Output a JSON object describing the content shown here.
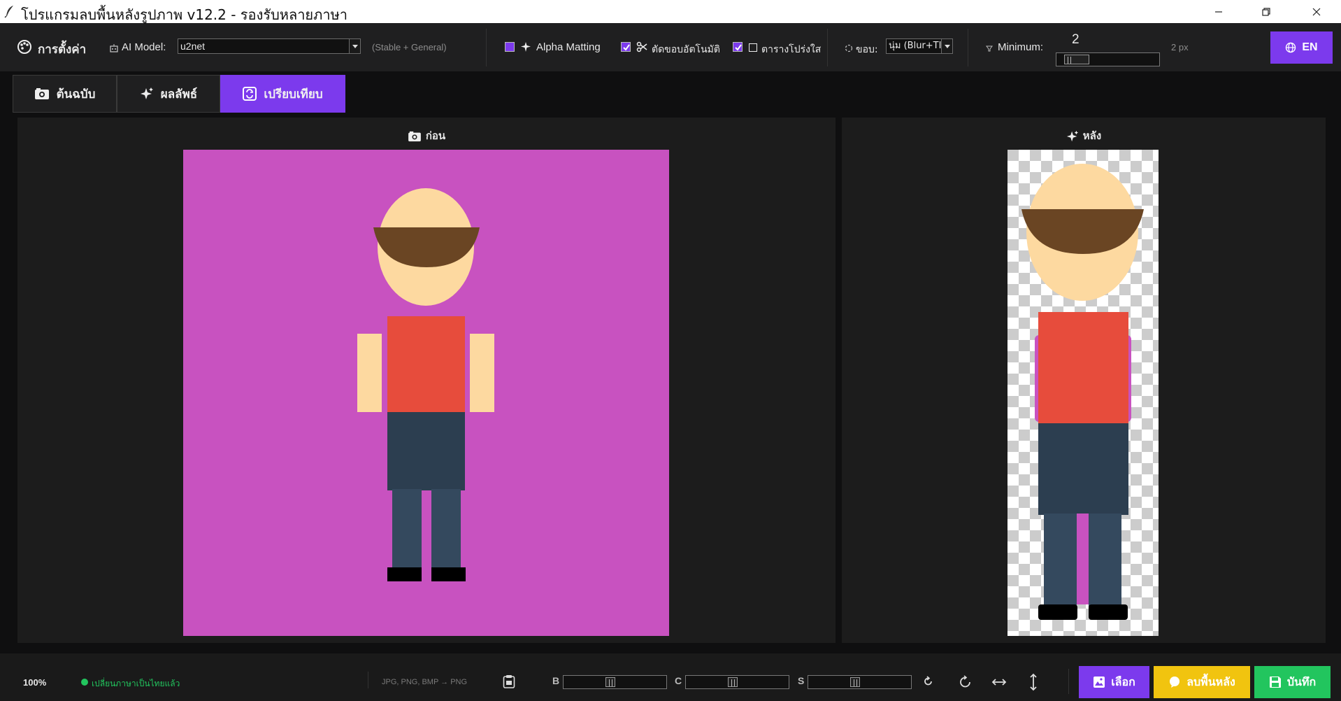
{
  "window": {
    "title": "โปรแกรมลบพื้นหลังรูปภาพ v12.2 - รองรับหลายภาษา"
  },
  "toolbar": {
    "settings_label": "การตั้งค่า",
    "ai_model_label": "AI Model:",
    "ai_model_value": "u2net",
    "ai_model_note": "(Stable + General)",
    "alpha_matting_label": "Alpha Matting",
    "alpha_matting_checked": true,
    "auto_crop_label": "ตัดขอบอัตโนมัติ",
    "auto_crop_checked": true,
    "transparent_grid_label": "ตารางโปร่งใส",
    "transparent_grid_checked": true,
    "edge_label": "ขอบ:",
    "edge_value": "นุ่ม (Blur+TI",
    "minimum_label": "Minimum:",
    "minimum_value": "2",
    "minimum_unit": "2 px",
    "minimum_level": 0.1,
    "lang_button_label": "EN"
  },
  "tabs": [
    {
      "label": "ต้นฉบับ",
      "icon": "photo-icon",
      "active": false
    },
    {
      "label": "ผลลัพธ์",
      "icon": "sparkle-icon",
      "active": false
    },
    {
      "label": "เปรียบเทียบ",
      "icon": "compare-icon",
      "active": true
    }
  ],
  "compare": {
    "before_label": "ก่อน",
    "after_label": "หลัง"
  },
  "colors": {
    "accent": "#7c3aed",
    "background_magenta": "#c852c0",
    "skin": "#fdd9a0",
    "hair": "#6a4523",
    "shirt": "#e74c3c",
    "pants": "#2c3e50",
    "legs": "#34495e",
    "shoes": "#000000",
    "remove_bg_button": "#f1c40f",
    "save_button": "#22c55e",
    "status_green": "#22c55e"
  },
  "statusbar": {
    "zoom": "100%",
    "status_message": "เปลี่ยนภาษาเป็นไทยแล้ว",
    "format_hint": "JPG, PNG, BMP → PNG",
    "brightness_label": "B",
    "contrast_label": "C",
    "saturation_label": "S",
    "brightness_level": 0.45,
    "contrast_level": 0.45,
    "saturation_level": 0.45,
    "choose_button": "เลือก",
    "remove_bg_button": "ลบพื้นหลัง",
    "save_button": "บันทึก"
  }
}
